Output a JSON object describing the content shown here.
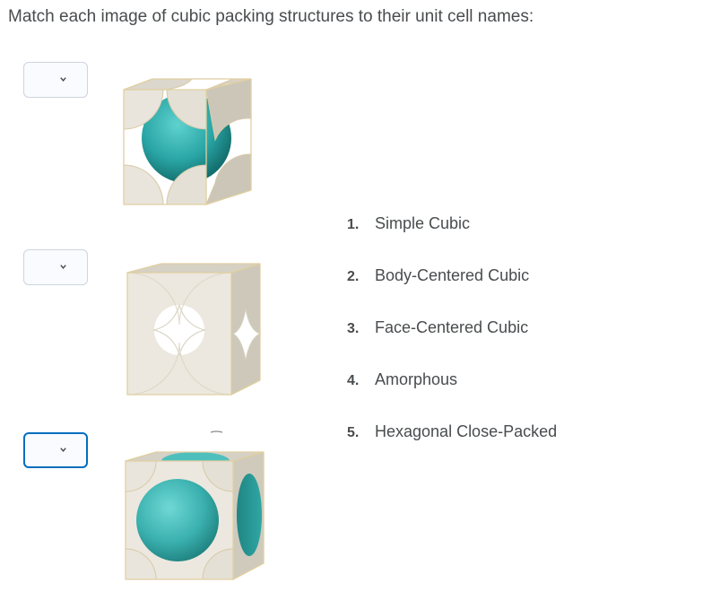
{
  "question": {
    "text": "Match each image of cubic packing structures to their unit cell names:"
  },
  "matches": [
    {
      "selected": "",
      "icon": "chevron-down-icon",
      "image": "unit-cell-body-centered"
    },
    {
      "selected": "",
      "icon": "chevron-down-icon",
      "image": "unit-cell-simple-cubic"
    },
    {
      "selected": "",
      "icon": "chevron-down-icon",
      "image": "unit-cell-face-centered"
    }
  ],
  "options": [
    {
      "number": "1.",
      "label": "Simple Cubic"
    },
    {
      "number": "2.",
      "label": "Body-Centered Cubic"
    },
    {
      "number": "3.",
      "label": "Face-Centered Cubic"
    },
    {
      "number": "4.",
      "label": "Amorphous"
    },
    {
      "number": "5.",
      "label": "Hexagonal Close-Packed"
    }
  ],
  "colors": {
    "text": "#494c4e",
    "select_border": "#cdd5dc",
    "select_focus": "#006fbf",
    "cube_face": "#e8e3d9",
    "cube_edge": "#d8c9a6",
    "sphere_teal": "#2aa6a6"
  }
}
